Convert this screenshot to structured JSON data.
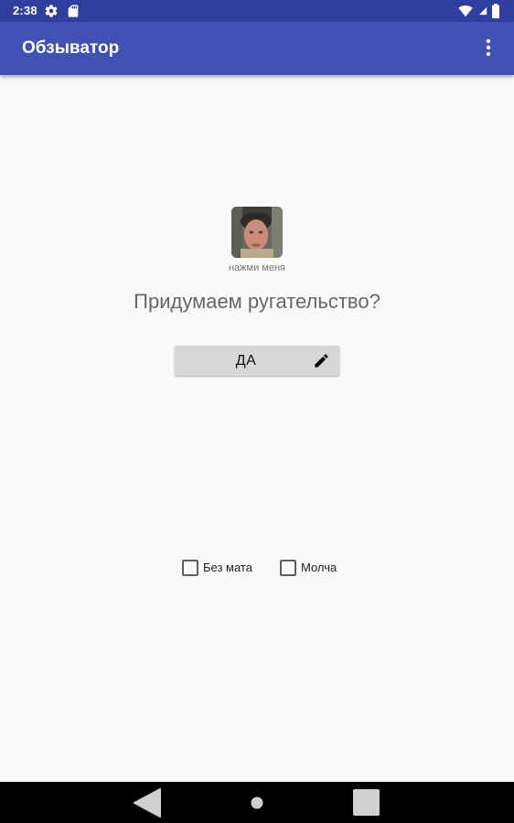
{
  "status_bar": {
    "time": "2:38",
    "icons": [
      "gear-icon",
      "sd-card-icon",
      "wifi-icon",
      "battery-icon"
    ]
  },
  "app_bar": {
    "title": "Обзыватор",
    "menu_icon": "overflow-menu-icon"
  },
  "main": {
    "avatar_caption": "нажми меня",
    "question": "Придумаем ругательство?",
    "yes_button": {
      "label": "ДА",
      "icon": "pencil-icon"
    },
    "options": [
      {
        "label": "Без мата",
        "checked": false
      },
      {
        "label": "Молча",
        "checked": false
      }
    ]
  },
  "nav_bar": {
    "buttons": [
      "back-icon",
      "home-icon",
      "recents-icon"
    ]
  },
  "colors": {
    "status_bar": "#303f9f",
    "app_bar": "#3f51b5",
    "background": "#fafafa",
    "button": "#d6d7d7"
  }
}
